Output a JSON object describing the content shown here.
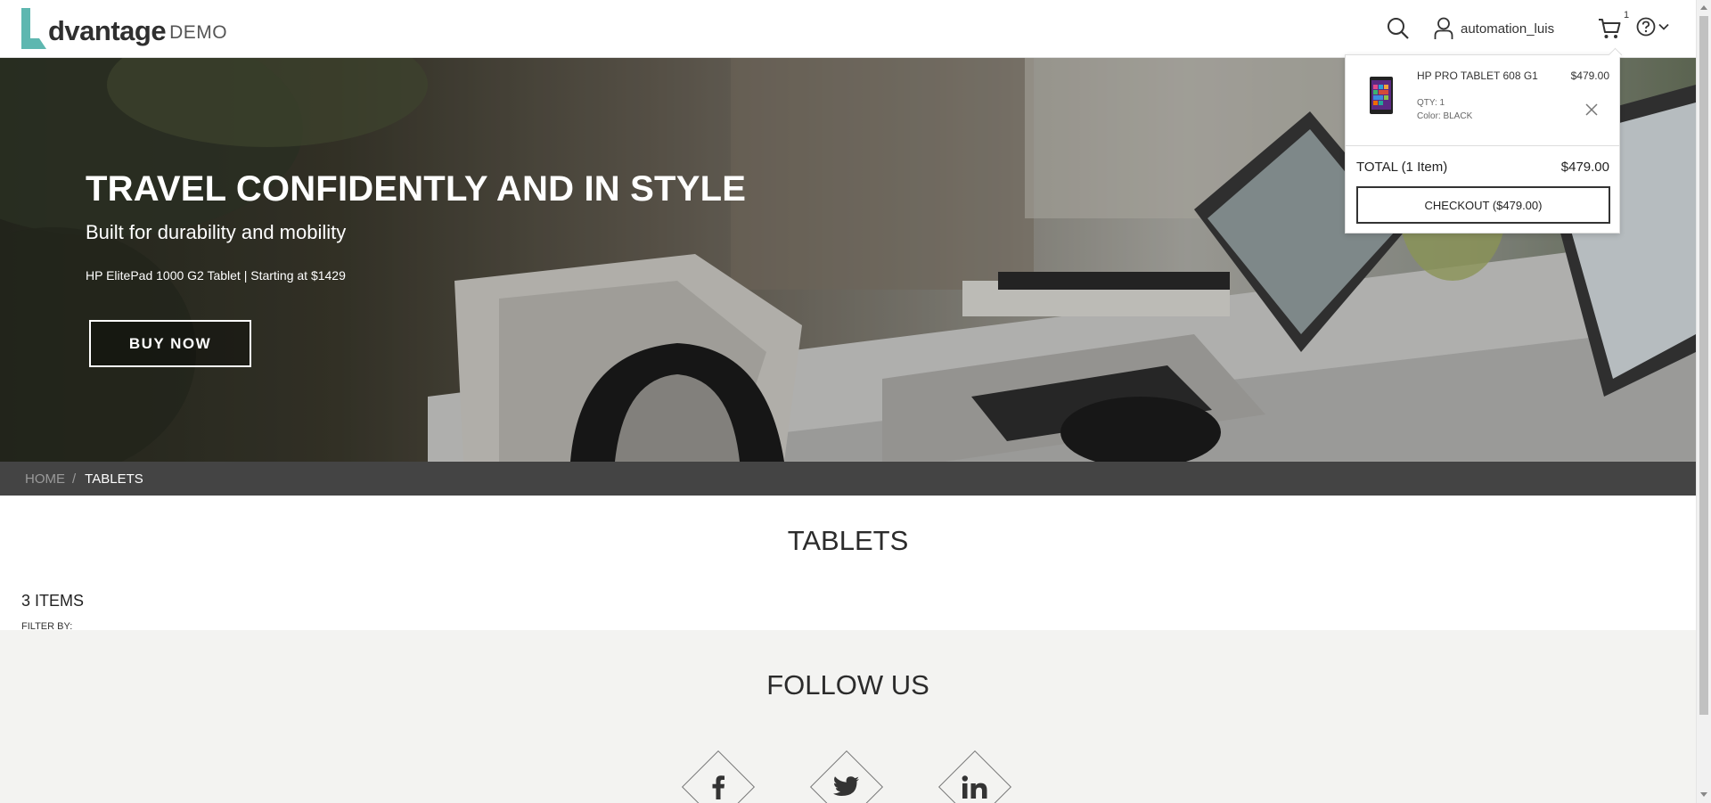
{
  "header": {
    "logo_word": "dvantage",
    "logo_demo": "DEMO",
    "user_name": "automation_luis",
    "cart_count": "1",
    "icons": [
      "search-icon",
      "user-icon",
      "cart-icon",
      "help-icon",
      "chevron-down-icon"
    ],
    "accent_color": "#5eb7b0"
  },
  "hero": {
    "title": "TRAVEL CONFIDENTLY AND IN STYLE",
    "subtitle": "Built for durability and mobility",
    "tagline": "HP ElitePad 1000 G2 Tablet | Starting at $1429",
    "button_label": "BUY NOW"
  },
  "breadcrumb": {
    "home": "HOME",
    "separator": "/",
    "current": "TABLETS"
  },
  "category": {
    "title": "TABLETS",
    "items_count": "3 ITEMS",
    "filter_label": "FILTER BY:"
  },
  "footer": {
    "follow_title": "FOLLOW US",
    "social": [
      {
        "name": "facebook-icon",
        "glyph": "f"
      },
      {
        "name": "twitter-icon",
        "glyph": "t"
      },
      {
        "name": "linkedin-icon",
        "glyph": "in"
      }
    ]
  },
  "cart_popup": {
    "item": {
      "name": "HP PRO TABLET 608 G1",
      "price": "$479.00",
      "qty": "QTY: 1",
      "color": "Color: BLACK"
    },
    "total_label": "TOTAL (1 Item)",
    "total_value": "$479.00",
    "checkout_label": "CHECKOUT ($479.00)"
  }
}
